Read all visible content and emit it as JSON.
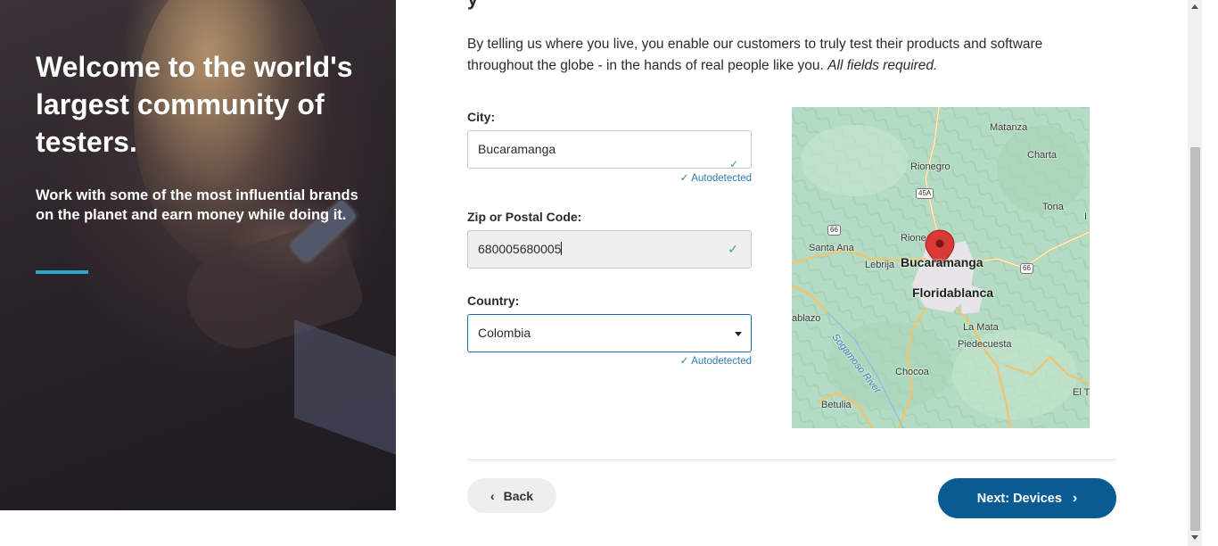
{
  "hero": {
    "title": "Welcome to the world's largest community of testers.",
    "subtitle": "Work with some of the most influential brands on the planet and earn money while doing it."
  },
  "intro": {
    "heading_fragment": "y",
    "text": "By telling us where you live, you enable our customers to truly test their products and software throughout the globe - in the hands of real people like you.",
    "required_note": "All fields required."
  },
  "form": {
    "city": {
      "label": "City:",
      "value": "Bucaramanga",
      "status": "Autodetected"
    },
    "zip": {
      "label": "Zip or Postal Code:",
      "value": "680005680005"
    },
    "country": {
      "label": "Country:",
      "value": "Colombia",
      "status": "Autodetected"
    }
  },
  "map": {
    "labels": {
      "matanza": "Matanza",
      "charta": "Charta",
      "rionegro": "Rionegro",
      "tona": "Tona",
      "santa_ana": "Santa Ana",
      "rione": "Rione",
      "lebrija": "Lebrija",
      "bucaramanga": "Bucaramanga",
      "floridablanca": "Floridablanca",
      "ablazo": "ablazo",
      "la_mata": "La Mata",
      "piedecuesta": "Piedecuesta",
      "sogamoso": "Sogamoso River",
      "chocoa": "Chocoa",
      "betulia": "Betulia",
      "el_t": "El T",
      "edge_i": "I"
    },
    "shields": {
      "s45a": "45A",
      "s66a": "66",
      "s66b": "66"
    },
    "colors": {
      "terrain": "#b4dcc4",
      "road": "#f5c36a",
      "urban": "#e8e4ea",
      "pin": "#d93a35"
    }
  },
  "actions": {
    "back_label": "Back",
    "next_label": "Next: Devices"
  }
}
